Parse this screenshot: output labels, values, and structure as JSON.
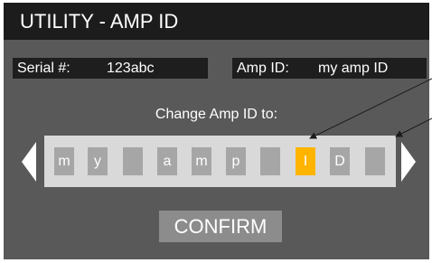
{
  "header": {
    "title": "UTILITY - AMP ID"
  },
  "serial": {
    "label": "Serial #:",
    "value": "123abc"
  },
  "amp_id": {
    "label": "Amp ID:",
    "value": "my amp ID"
  },
  "editor": {
    "prompt": "Change Amp ID to:",
    "characters": [
      "m",
      "y",
      "",
      "a",
      "m",
      "p",
      "",
      "I",
      "D",
      ""
    ],
    "selected_index": 7
  },
  "confirm": {
    "label": "CONFIRM"
  },
  "colors": {
    "background": "#595959",
    "title_bar": "#1c1c1c",
    "field_bg": "#1e1e1e",
    "strip_bg": "#d9d9d9",
    "slot_bg": "#a6a6a6",
    "selected": "#ffb400",
    "button_bg": "#8c8c8c"
  },
  "icons": {
    "prev": "triangle-left-icon",
    "next": "triangle-right-icon"
  }
}
